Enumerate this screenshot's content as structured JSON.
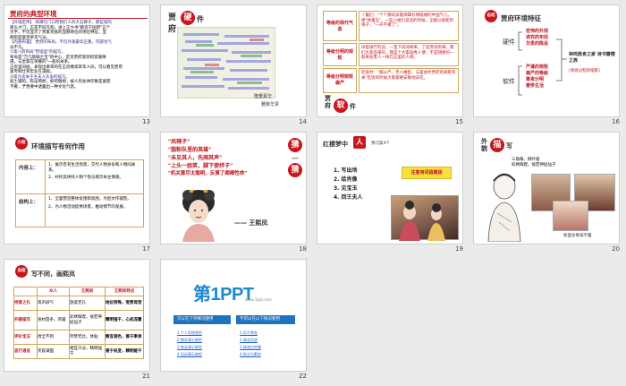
{
  "slide13": {
    "number": "13",
    "title": "贾府的典型环境",
    "lines": [
      "【外观宏伟】  郑潭在门口所我们人的大石狮子，那些城的",
      "兽头大门，正是不同凡响，进上正大书\"敕造宁国府\"五个",
      "大字，不仅显示了贾家贵族的显赫地位的地位特征，显",
      "赫则是富贵荣华气派。",
      "【内部布置】  贾府的布局，不仅外观豪华庄重，内部也气",
      "派不凡。",
      "①第八府布局\"赞墙里\"的描写。",
      "  布局是\"万几宸翰之宝\"的中心，足见贾府受到的宠施殊",
      "遇，与皇家在荣耀的\"一般的关系。",
      "  正房里同居，表现出来荣的在正房楼高荣华人间，可以看见贾府",
      "富专制仕荣宏业在道殿。",
      "②第九房关于主夫人东舍的描写。",
      "  就土铺的，陈设简陋，如何随想，被人的总体印象是富而",
      "不奢，予贾要中透露出一种文化气息。"
    ]
  },
  "slide14": {
    "number": "14",
    "title_a": "贾",
    "title_b": "府",
    "stamp": "硬",
    "title_c": "件",
    "caption_a": "隆重豪华",
    "caption_b": "雅致华贵"
  },
  "slide15": {
    "number": "15",
    "rows": [
      {
        "label": "等级的现代气息",
        "text": "丫鬟们：\"个个都同穿着绸罩衫绸缎裙的中国气儿，便\"林黛玉\"，一些小姐们说话的时候，全都以规矩的样子，\"一声不嗽了\"。"
      },
      {
        "label": "等级分明的规矩",
        "text": "凤姐进厅的途，一直下房同样来，了迎贾母到来，我们大家后来的，我是个大家闺秀人便，不是随便的一般来往客人一样在这里的人便。"
      },
      {
        "label": "等级分明规矩森严",
        "text": "吃饭时：\"都从严，无人敢乱，与宴会时贾府的规矩有关\"吃饭的时候大家都要安静地去吃。"
      }
    ],
    "side_a": "贾",
    "side_b": "府",
    "stamp": "软",
    "side_c": "件"
  },
  "slide16": {
    "number": "16",
    "badge": "总结",
    "title": "贾府环境特征",
    "hard_label": "硬件",
    "hard_items": [
      "宏伟的外观",
      "讲究的布局",
      "华贵的陈设"
    ],
    "soft_label": "软件",
    "soft_items": [
      "严谨的规矩",
      "森严的等级",
      "尊卑分明",
      "奢侈生活"
    ],
    "conclusion": "钟鸣鼎食之家 诗书簪缨之族",
    "note": "(衰败过程的缩影)"
  },
  "slide17": {
    "number": "17",
    "badge": "小结",
    "title": "环境描写有何作用",
    "rows": [
      {
        "label": "内容上：",
        "items": [
          "1、展示百有生活场景，交代人物身份和人物间关系。",
          "2、衬托及烘托人物个性与揭示本主情感。"
        ]
      },
      {
        "label": "结构上：",
        "items": [
          "1、全面营造整体氛围和氛围，为后文作铺垫。",
          "2、为人物活动提供场景，推动情节的发展。"
        ]
      }
    ]
  },
  "slide18": {
    "number": "18",
    "quotes": [
      "\"凤辣子\"",
      "\"脂粉队里的英雄\"",
      "\"未见其人，先闻其声\"",
      "\"上头一脸笑，脚下使绊子\"",
      "\"机关算尽太聪明，反算了卿卿性命\""
    ],
    "stamp_top": "猜",
    "stamp_bottom": "猜",
    "divider": "一",
    "answer": "—— 王熙凤"
  },
  "slide19": {
    "number": "19",
    "title": "红楼梦中",
    "stamp": "人",
    "subtitle": "预习案#7",
    "items": [
      "1. 写出场",
      "2. 绘肖像",
      "3. 见宝玉",
      "4. 回王夫人"
    ],
    "note": "注意用词语概括"
  },
  "slide20": {
    "number": "20",
    "title_a": "外貌",
    "stamp": "描",
    "title_b": "写",
    "lines": [
      "三角眼、柳叶眉",
      "彩绣辉煌，恍若神妃仙子"
    ],
    "caption": "粉面含春威不露"
  },
  "slide21": {
    "number": "21",
    "badge": "总结",
    "title": "写不同，画熙凤",
    "headers": [
      "",
      "众人",
      "王熙凤",
      "王熙凤特点"
    ],
    "rows": [
      [
        "待客之礼",
        "敛声屏气",
        "放诞无礼",
        "地位特殊，受贾母宠"
      ],
      [
        "外貌描写",
        "身材苗条，风骚",
        "彩绣辉煌，恍若神妃仙子",
        "精明强干，心机深重"
      ],
      [
        "评价宝玉",
        "周全不到",
        "夸赞无比，体贴",
        "察言观色，善于奉承"
      ],
      [
        "言行语言",
        "笑容满面",
        "相互冷淡，精明强干",
        "善于机变，精明能干"
      ]
    ]
  },
  "slide22": {
    "number": "22",
    "logo_text": "第1PPT",
    "logo_url": "www.1ppt.com",
    "left_btn": "可以在下列情况使用",
    "right_btn": "不可以在以下情况使用",
    "left_links": [
      "1.个人用途使用",
      "2.教学演示使用",
      "3.商业演示使用",
      "4.培训演示使用"
    ],
    "right_links": [
      "1.用于倒卖",
      "2.商业用途",
      "3.修改后传播",
      "4.拆分为素材"
    ]
  }
}
